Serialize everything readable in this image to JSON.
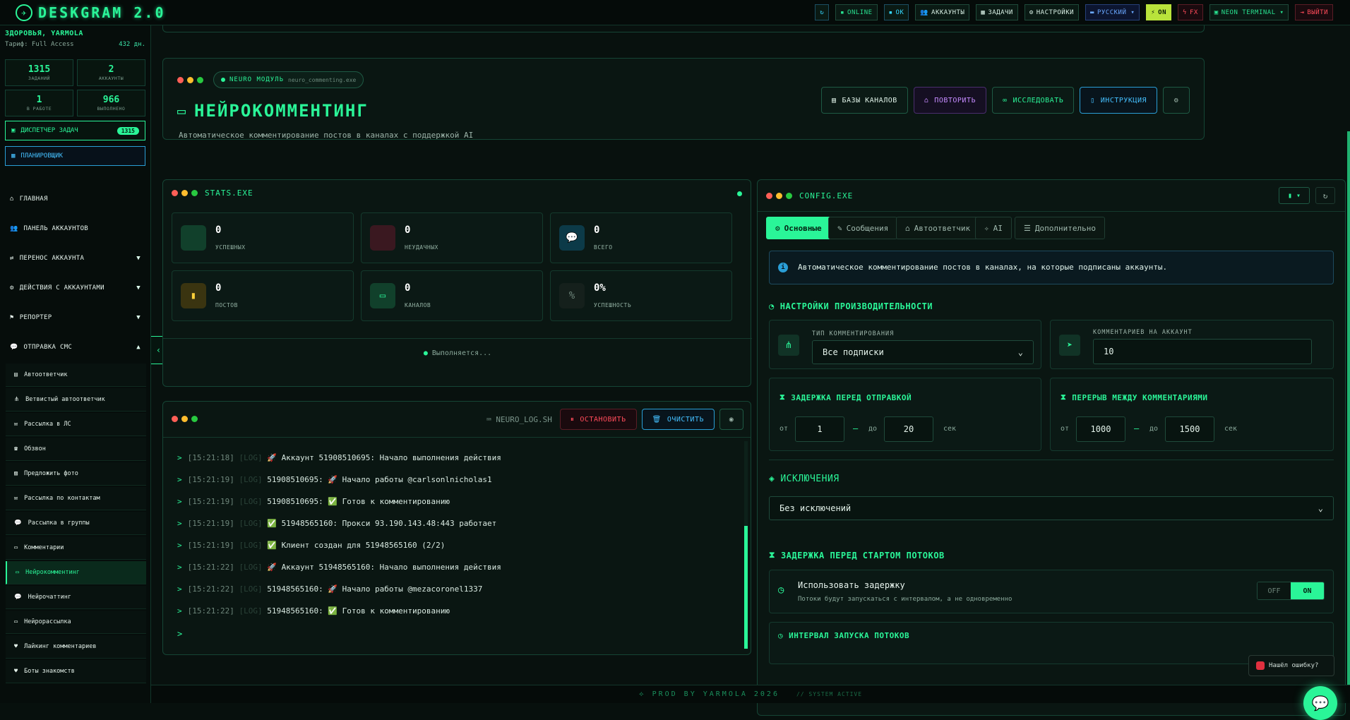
{
  "app": {
    "title": "DESKGRAM 2.0"
  },
  "topbar": {
    "buttons": [
      {
        "label": "ONLINE",
        "icon": "dot-icon",
        "style": "grn"
      },
      {
        "label": "OK",
        "icon": "square-icon",
        "style": "cyan"
      },
      {
        "label": "АККАУНТЫ",
        "icon": "users-icon",
        "style": ""
      },
      {
        "label": "ЗАДАЧИ",
        "icon": "tasks-icon",
        "style": ""
      },
      {
        "label": "НАСТРОЙКИ",
        "icon": "gear-icon",
        "style": ""
      },
      {
        "label": "РУССКИЙ ▾",
        "icon": "flag-icon",
        "style": "blue"
      },
      {
        "label": "ON",
        "icon": "bolt-icon",
        "style": "on"
      },
      {
        "label": "FX",
        "icon": "fx-icon",
        "style": "red"
      },
      {
        "label": "NEON TERMINAL ▾",
        "icon": "terminal-icon",
        "style": "grn"
      },
      {
        "label": "ВЫЙТИ",
        "icon": "logout-icon",
        "style": "red"
      }
    ]
  },
  "sidebar": {
    "user": "ЗДОРОВЬЯ, YARMOLA",
    "tariff_label": "Тариф: Full Access",
    "days": "432 дн.",
    "stats": [
      {
        "n": "1315",
        "l": "ЗАДАНИЙ"
      },
      {
        "n": "2",
        "l": "АККАУНТЫ"
      },
      {
        "n": "1",
        "l": "В РАБОТЕ"
      },
      {
        "n": "966",
        "l": "ВЫПОЛНЕНО"
      }
    ],
    "dispatcher": "ДИСПЕТЧЕР ЗАДАЧ",
    "dispatcher_badge": "1315",
    "planner": "ПЛАНИРОВЩИК",
    "nav": [
      {
        "label": "ГЛАВНАЯ",
        "chev": ""
      },
      {
        "label": "ПАНЕЛЬ АККАУНТОВ",
        "chev": ""
      },
      {
        "label": "ПЕРЕНОС АККАУНТА",
        "chev": "▼"
      },
      {
        "label": "ДЕЙСТВИЯ С АККАУНТАМИ",
        "chev": "▼"
      },
      {
        "label": "РЕПОРТЕР",
        "chev": "▼"
      },
      {
        "label": "ОТПРАВКА СМС",
        "chev": "▲"
      }
    ],
    "sub": [
      "Автоответчик",
      "Ветвистый автоответчик",
      "Рассылка в ЛС",
      "Обзвон",
      "Предложить фото",
      "Рассылка по контактам",
      "Рассылка в группы",
      "Комментарии",
      "Нейрокомментинг",
      "Нейрочаттинг",
      "Нейрорассылка",
      "Лайкинг комментариев",
      "Боты знакомств"
    ]
  },
  "header": {
    "module": "NEURO МОДУЛЬ",
    "file": "neuro_commenting.exe",
    "title": "НЕЙРОКОММЕНТИНГ",
    "desc": "Автоматическое комментирование постов в каналах с поддержкой AI",
    "buttons": {
      "bases": "БАЗЫ КАНАЛОВ",
      "repeat": "ПОВТОРИТЬ",
      "research": "ИССЛЕДОВАТЬ",
      "instr": "ИНСТРУКЦИЯ"
    }
  },
  "stats": {
    "title": "STATS.EXE",
    "running": "Выполняется...",
    "cards": [
      {
        "v": "0",
        "l": "УСПЕШНЫХ"
      },
      {
        "v": "0",
        "l": "НЕУДАЧНЫХ"
      },
      {
        "v": "0",
        "l": "ВСЕГО"
      },
      {
        "v": "0",
        "l": "ПОСТОВ"
      },
      {
        "v": "0",
        "l": "КАНАЛОВ"
      },
      {
        "v": "0%",
        "l": "УСПЕШНОСТЬ"
      }
    ]
  },
  "log": {
    "title": "NEURO_LOG.SH",
    "stop": "ОСТАНОВИТЬ",
    "clear": "ОЧИСТИТЬ",
    "lines": [
      {
        "ts": "[15:21:18]",
        "e": "🚀",
        "t": "Аккаунт 51908510695: Начало выполнения действия",
        "pre": ""
      },
      {
        "ts": "[15:21:19]",
        "e": "🚀",
        "t": "Начало работы @carlsonlnicholas1",
        "pre": "51908510695: "
      },
      {
        "ts": "[15:21:19]",
        "e": "✅",
        "t": "Готов к комментированию",
        "pre": "51908510695: "
      },
      {
        "ts": "[15:21:19]",
        "e": "✅",
        "t": "51948565160: Прокси 93.190.143.48:443 работает",
        "pre": ""
      },
      {
        "ts": "[15:21:19]",
        "e": "✅",
        "t": "Клиент создан для 51948565160 (2/2)",
        "pre": ""
      },
      {
        "ts": "[15:21:22]",
        "e": "🚀",
        "t": "Аккаунт 51948565160: Начало выполнения действия",
        "pre": ""
      },
      {
        "ts": "[15:21:22]",
        "e": "🚀",
        "t": "Начало работы @mezacoronel1337",
        "pre": "51948565160: "
      },
      {
        "ts": "[15:21:22]",
        "e": "✅",
        "t": "Готов к комментированию",
        "pre": "51948565160: "
      }
    ],
    "tag": "[LOG]"
  },
  "config": {
    "title": "CONFIG.EXE",
    "tabs": [
      "Основные",
      "Сообщения",
      "Автоответчик",
      "AI",
      "Дополнительно"
    ],
    "info": "Автоматическое комментирование постов в каналах, на которые подписаны аккаунты.",
    "perf": "НАСТРОЙКИ ПРОИЗВОДИТЕЛЬНОСТИ",
    "type_label": "ТИП КОММЕНТИРОВАНИЯ",
    "type_value": "Все подписки",
    "per_acc_label": "КОММЕНТАРИЕВ НА АККАУНТ",
    "per_acc_value": "10",
    "delay_title": "ЗАДЕРЖКА ПЕРЕД ОТПРАВКОЙ",
    "delay_from": "1",
    "delay_to": "20",
    "break_title": "ПЕРЕРЫВ МЕЖДУ КОММЕНТАРИЯМИ",
    "break_from": "1000",
    "break_to": "1500",
    "from": "от",
    "to": "до",
    "sec": "сек",
    "excl": "ИСКЛЮЧЕНИЯ",
    "excl_value": "Без исключений",
    "start_delay": "ЗАДЕРЖКА ПЕРЕД СТАРТОМ ПОТОКОВ",
    "use_delay": "Использовать задержку",
    "use_delay_sub": "Потоки будут запускаться с интервалом, а не одновременно",
    "off": "OFF",
    "on": "ON",
    "interval": "ИНТЕРВАЛ ЗАПУСКА ПОТОКОВ"
  },
  "footer": {
    "left": "⟡ PROD BY YARMOLA 2026",
    "right": "// SYSTEM ACTIVE"
  },
  "bug": "Нашёл ошибку?"
}
